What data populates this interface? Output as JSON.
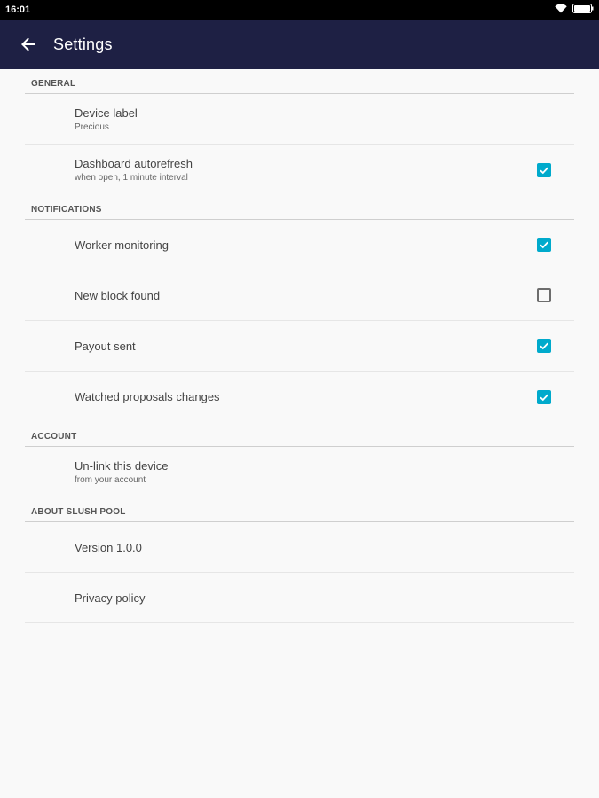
{
  "status_bar": {
    "time": "16:01",
    "icons": [
      "wifi-icon",
      "battery-icon"
    ]
  },
  "toolbar": {
    "back_icon": "arrow-back-icon",
    "title": "Settings"
  },
  "colors": {
    "app_bar": "#1e2044",
    "accent": "#00aacc",
    "background": "#f9f9f9"
  },
  "sections": {
    "general": {
      "header": "GENERAL",
      "device_label": {
        "title": "Device label",
        "summary": "Precious"
      },
      "dashboard_autorefresh": {
        "title": "Dashboard autorefresh",
        "summary": "when open, 1 minute interval",
        "checked": true
      }
    },
    "notifications": {
      "header": "NOTIFICATIONS",
      "worker_monitoring": {
        "title": "Worker monitoring",
        "checked": true
      },
      "new_block_found": {
        "title": "New block found",
        "checked": false
      },
      "payout_sent": {
        "title": "Payout sent",
        "checked": true
      },
      "watched_proposals": {
        "title": "Watched proposals changes",
        "checked": true
      }
    },
    "account": {
      "header": "ACCOUNT",
      "unlink": {
        "title": "Un-link this device",
        "summary": "from your account"
      }
    },
    "about": {
      "header": "ABOUT SLUSH POOL",
      "version": {
        "title": "Version 1.0.0"
      },
      "privacy": {
        "title": "Privacy policy"
      }
    }
  }
}
